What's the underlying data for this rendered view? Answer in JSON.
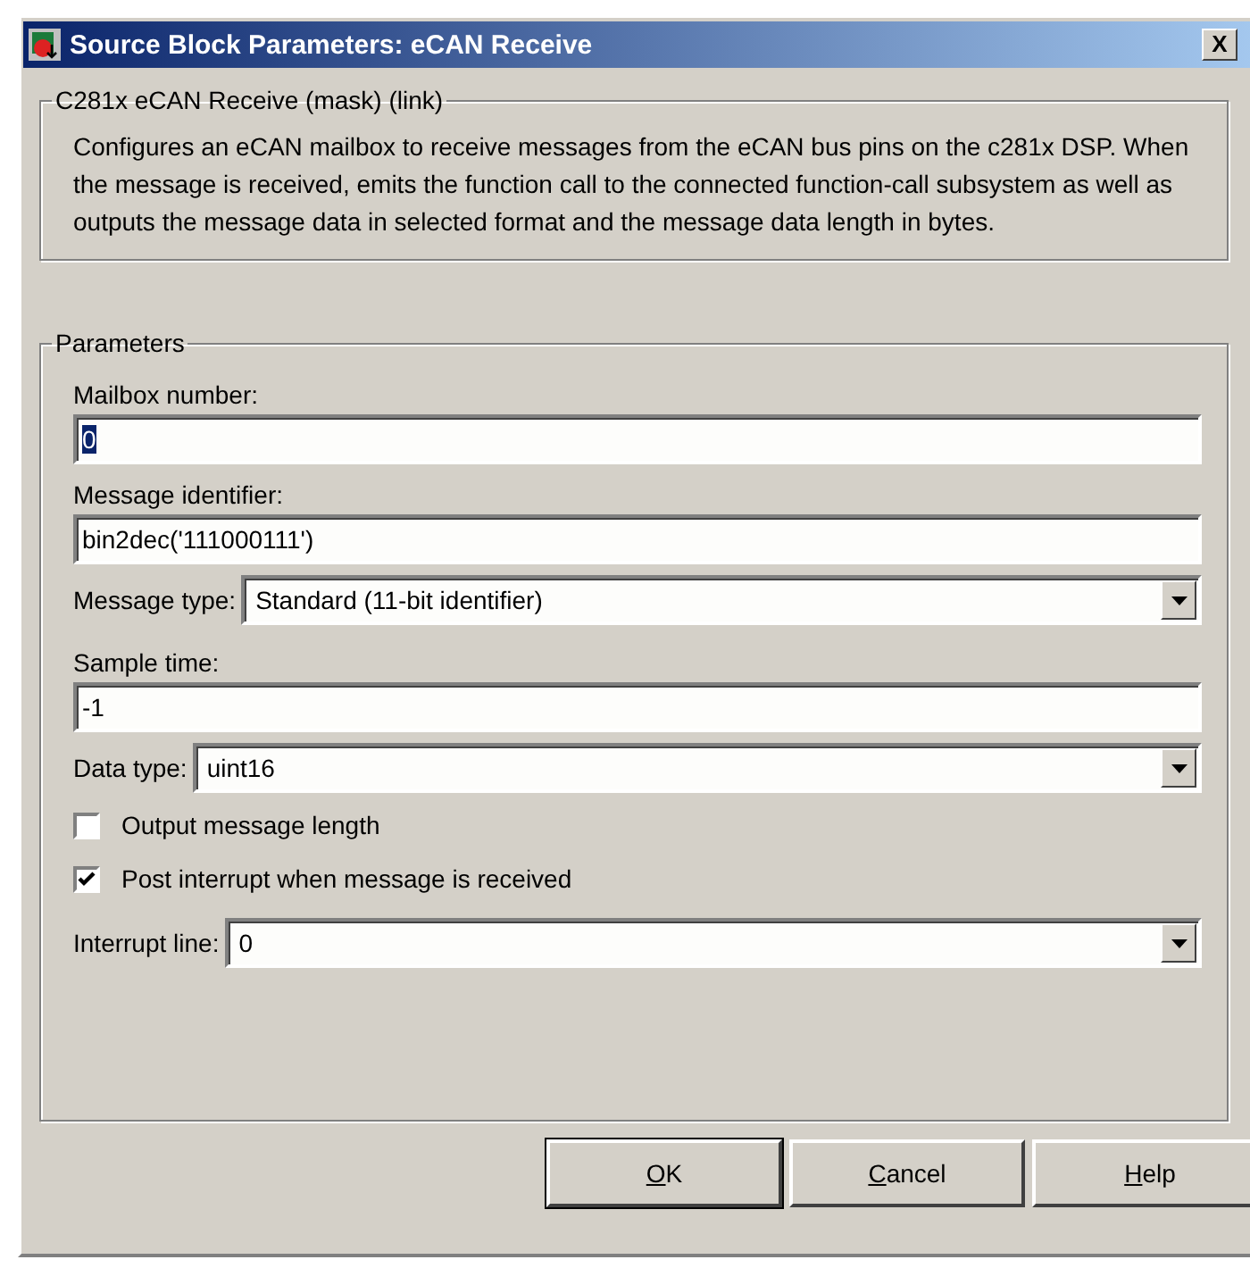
{
  "window": {
    "title": "Source Block Parameters: eCAN Receive",
    "close": "X"
  },
  "description": {
    "title": "C281x eCAN Receive (mask) (link)",
    "text": "Configures an eCAN mailbox to receive messages from the eCAN bus pins on the c281x DSP. When the message is received, emits the function call to the connected function-call subsystem as well as outputs the message data in selected format and the message data length in bytes."
  },
  "parameters": {
    "title": "Parameters",
    "items": [
      {
        "kind": "text",
        "label": "Mailbox number:",
        "value": "0",
        "highlighted": true
      },
      {
        "kind": "text",
        "label": "Message identifier:",
        "value": "bin2dec('111000111')",
        "highlighted": false
      },
      {
        "kind": "dropdown",
        "label": "Message type:",
        "value": "Standard (11-bit identifier)"
      },
      {
        "kind": "text",
        "label": "Sample time:",
        "value": "-1",
        "highlighted": false
      },
      {
        "kind": "dropdown",
        "label": "Data type:",
        "value": "uint16"
      },
      {
        "kind": "checkbox",
        "label": "Output message length",
        "checked": false
      },
      {
        "kind": "checkbox",
        "label": "Post interrupt when message is received",
        "checked": true
      },
      {
        "kind": "dropdown",
        "label": "Interrupt line:",
        "value": "0"
      }
    ]
  },
  "buttons": [
    "OK",
    "Cancel",
    "Help"
  ]
}
